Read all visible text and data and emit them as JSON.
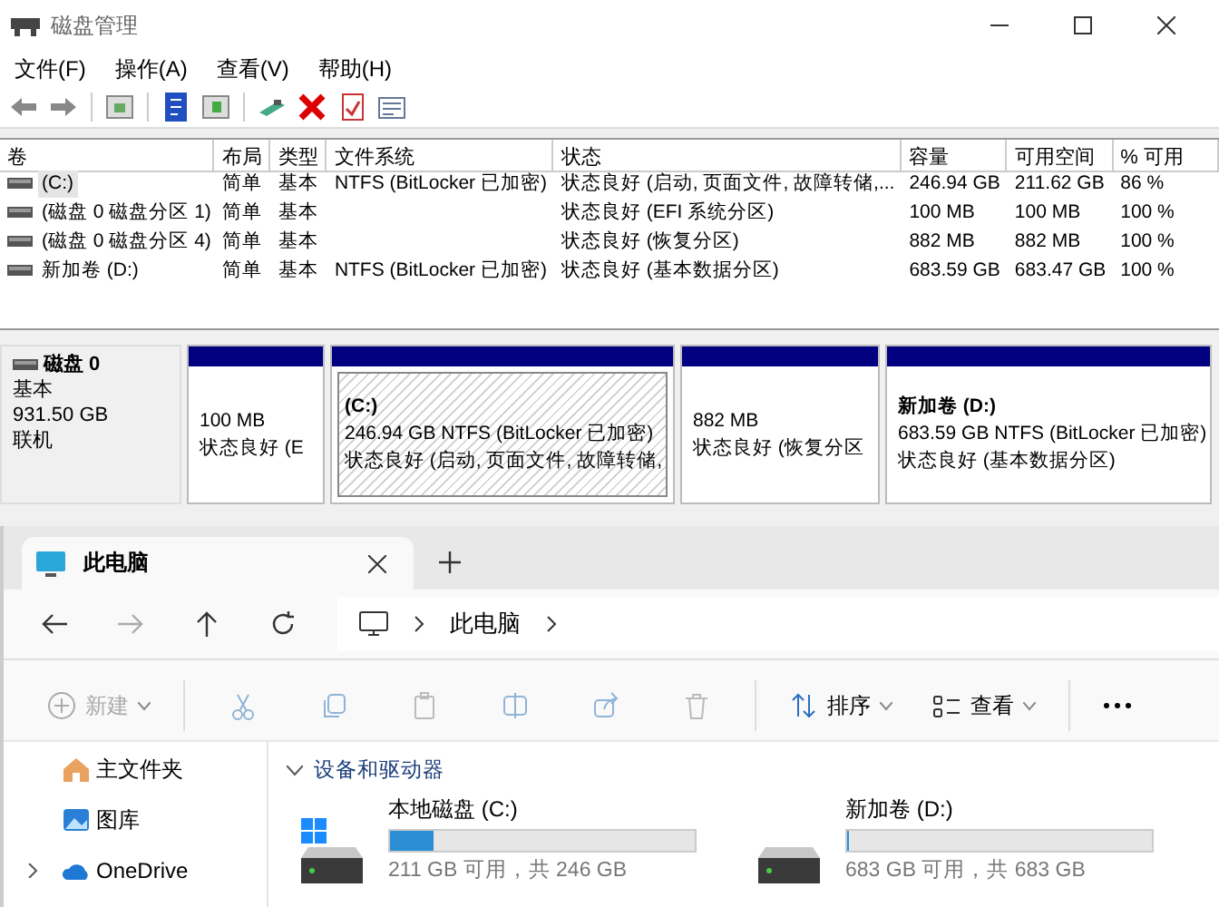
{
  "disk_management": {
    "title": "磁盘管理",
    "menu": [
      "文件(F)",
      "操作(A)",
      "查看(V)",
      "帮助(H)"
    ],
    "table": {
      "columns": [
        "卷",
        "布局",
        "类型",
        "文件系统",
        "状态",
        "容量",
        "可用空间",
        "% 可用"
      ],
      "rows": [
        {
          "selected": true,
          "cells": [
            "(C:)",
            "简单",
            "基本",
            "NTFS (BitLocker 已加密)",
            "状态良好 (启动, 页面文件, 故障转储,...",
            "246.94 GB",
            "211.62 GB",
            "86 %"
          ]
        },
        {
          "selected": false,
          "cells": [
            "(磁盘 0 磁盘分区 1)",
            "简单",
            "基本",
            "",
            "状态良好 (EFI 系统分区)",
            "100 MB",
            "100 MB",
            "100 %"
          ]
        },
        {
          "selected": false,
          "cells": [
            "(磁盘 0 磁盘分区 4)",
            "简单",
            "基本",
            "",
            "状态良好 (恢复分区)",
            "882 MB",
            "882 MB",
            "100 %"
          ]
        },
        {
          "selected": false,
          "cells": [
            "新加卷 (D:)",
            "简单",
            "基本",
            "NTFS (BitLocker 已加密)",
            "状态良好 (基本数据分区)",
            "683.59 GB",
            "683.47 GB",
            "100 %"
          ]
        }
      ]
    },
    "disk": {
      "name": "磁盘 0",
      "type": "基本",
      "size": "931.50 GB",
      "status": "联机",
      "partitions": [
        {
          "selected": false,
          "lines": [
            "100 MB",
            "状态良好 (E"
          ]
        },
        {
          "selected": true,
          "title": "(C:)",
          "lines": [
            "246.94 GB NTFS (BitLocker 已加密)",
            "状态良好 (启动, 页面文件, 故障转储,"
          ]
        },
        {
          "selected": false,
          "lines": [
            "882 MB",
            "状态良好 (恢复分区"
          ]
        },
        {
          "selected": false,
          "title": "新加卷  (D:)",
          "lines": [
            "683.59 GB NTFS (BitLocker 已加密)",
            "状态良好 (基本数据分区)"
          ]
        }
      ]
    }
  },
  "explorer": {
    "tab": {
      "label": "此电脑"
    },
    "breadcrumb": [
      "此电脑"
    ],
    "commands": [
      {
        "label": "新建",
        "disabled": true
      },
      {
        "label": "排序",
        "disabled": false
      },
      {
        "label": "查看",
        "disabled": false
      }
    ],
    "sidebar": [
      {
        "label": "主文件夹"
      },
      {
        "label": "图库"
      },
      {
        "label": "OneDrive",
        "expanded": false
      }
    ],
    "section": {
      "title": "设备和驱动器",
      "expanded": true
    },
    "drives": [
      {
        "name": "本地磁盘 (C:)",
        "level": 0.14,
        "free": "211 GB 可用，共 246 GB",
        "system": true
      },
      {
        "name": "新加卷 (D:)",
        "level": 0,
        "free": "683 GB 可用，共 683 GB",
        "system": false
      }
    ]
  }
}
